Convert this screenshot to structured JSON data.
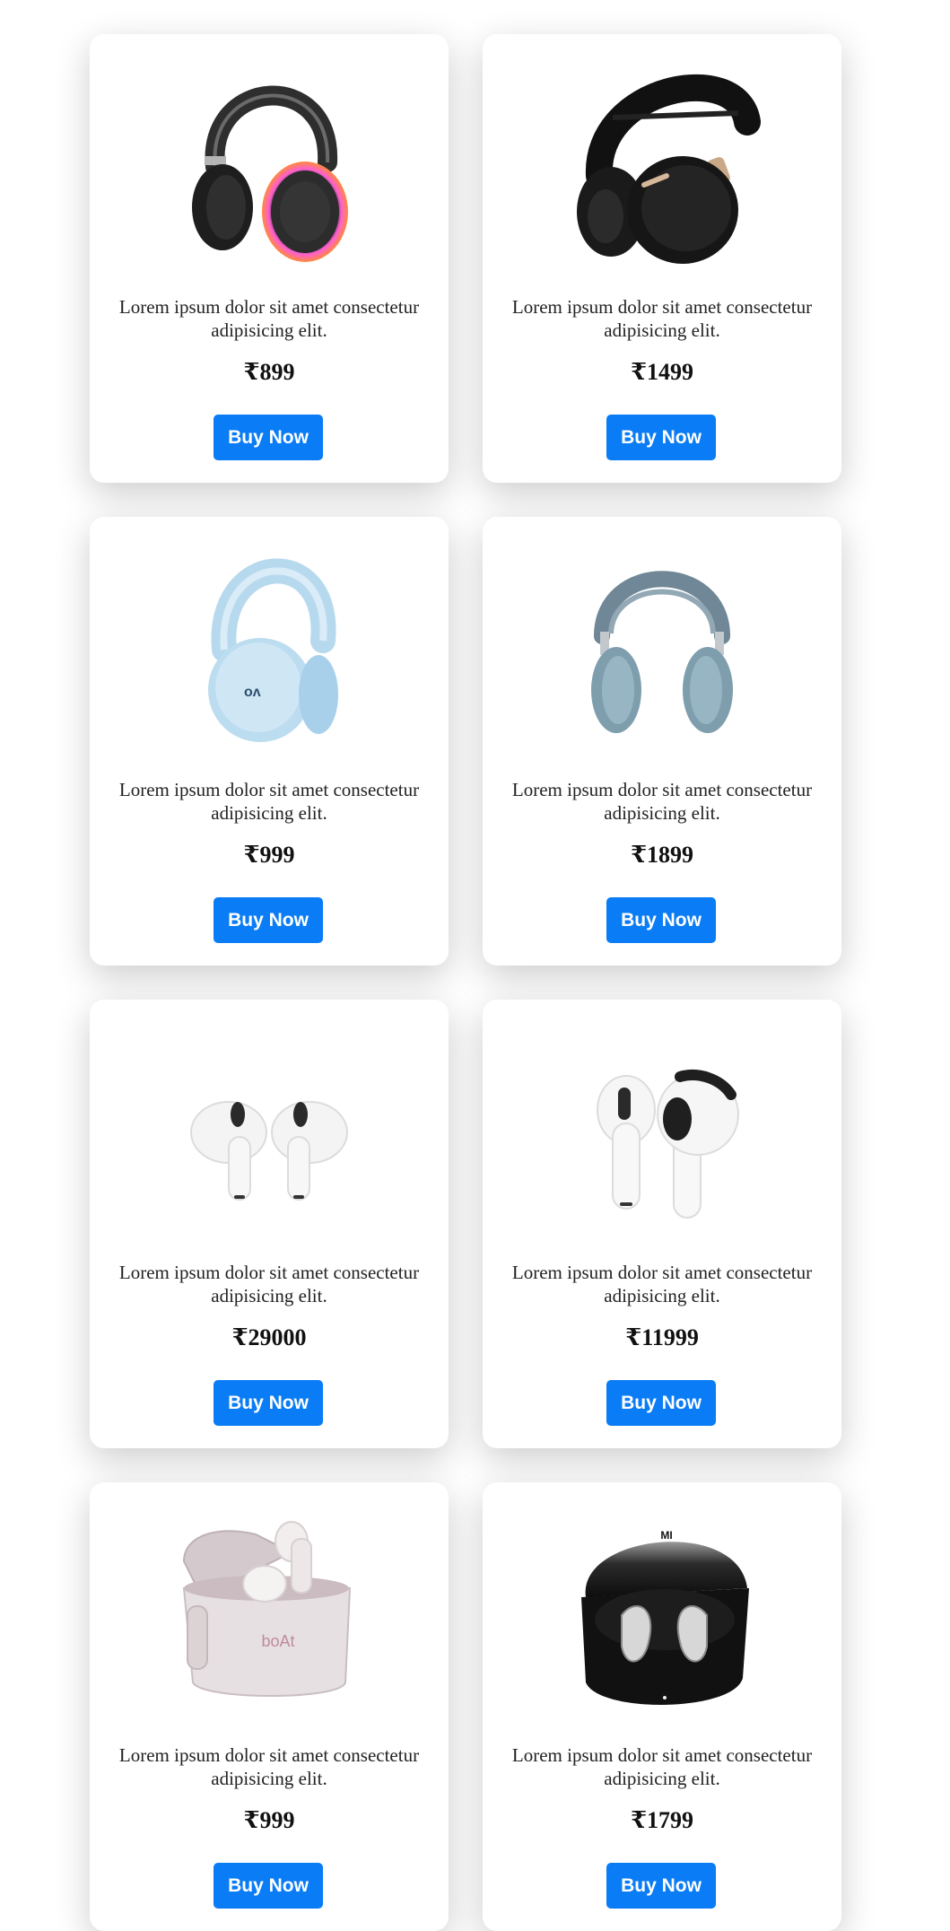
{
  "colors": {
    "button": "#0a7cf5",
    "button_text": "#ffffff",
    "card_bg": "#ffffff"
  },
  "products": [
    {
      "image": "black over-ear headphones with RGB ring",
      "description": "Lorem ipsum dolor sit amet consectetur adipisicing elit.",
      "price": "₹899",
      "button_label": "Buy Now"
    },
    {
      "image": "black over-ear headphones with gold hinge",
      "description": "Lorem ipsum dolor sit amet consectetur adipisicing elit.",
      "price": "₹1499",
      "button_label": "Buy Now"
    },
    {
      "image": "light blue over-ear headphones",
      "description": "Lorem ipsum dolor sit amet consectetur adipisicing elit.",
      "price": "₹999",
      "button_label": "Buy Now"
    },
    {
      "image": "sky blue over-ear headphones",
      "description": "Lorem ipsum dolor sit amet consectetur adipisicing elit.",
      "price": "₹1899",
      "button_label": "Buy Now"
    },
    {
      "image": "white wireless earbuds pair",
      "description": "Lorem ipsum dolor sit amet consectetur adipisicing elit.",
      "price": "₹29000",
      "button_label": "Buy Now"
    },
    {
      "image": "white wireless earbuds pair",
      "description": "Lorem ipsum dolor sit amet consectetur adipisicing elit.",
      "price": "₹11999",
      "button_label": "Buy Now"
    },
    {
      "image": "pearl earbuds in open charging case",
      "description": "Lorem ipsum dolor sit amet consectetur adipisicing elit.",
      "price": "₹999",
      "button_label": "Buy Now"
    },
    {
      "image": "black earbuds in open charging case",
      "description": "Lorem ipsum dolor sit amet consectetur adipisicing elit.",
      "price": "₹1799",
      "button_label": "Buy Now"
    }
  ],
  "product_logos": {
    "pearl_case_logo": "boAt",
    "black_case_logo": "MI"
  }
}
